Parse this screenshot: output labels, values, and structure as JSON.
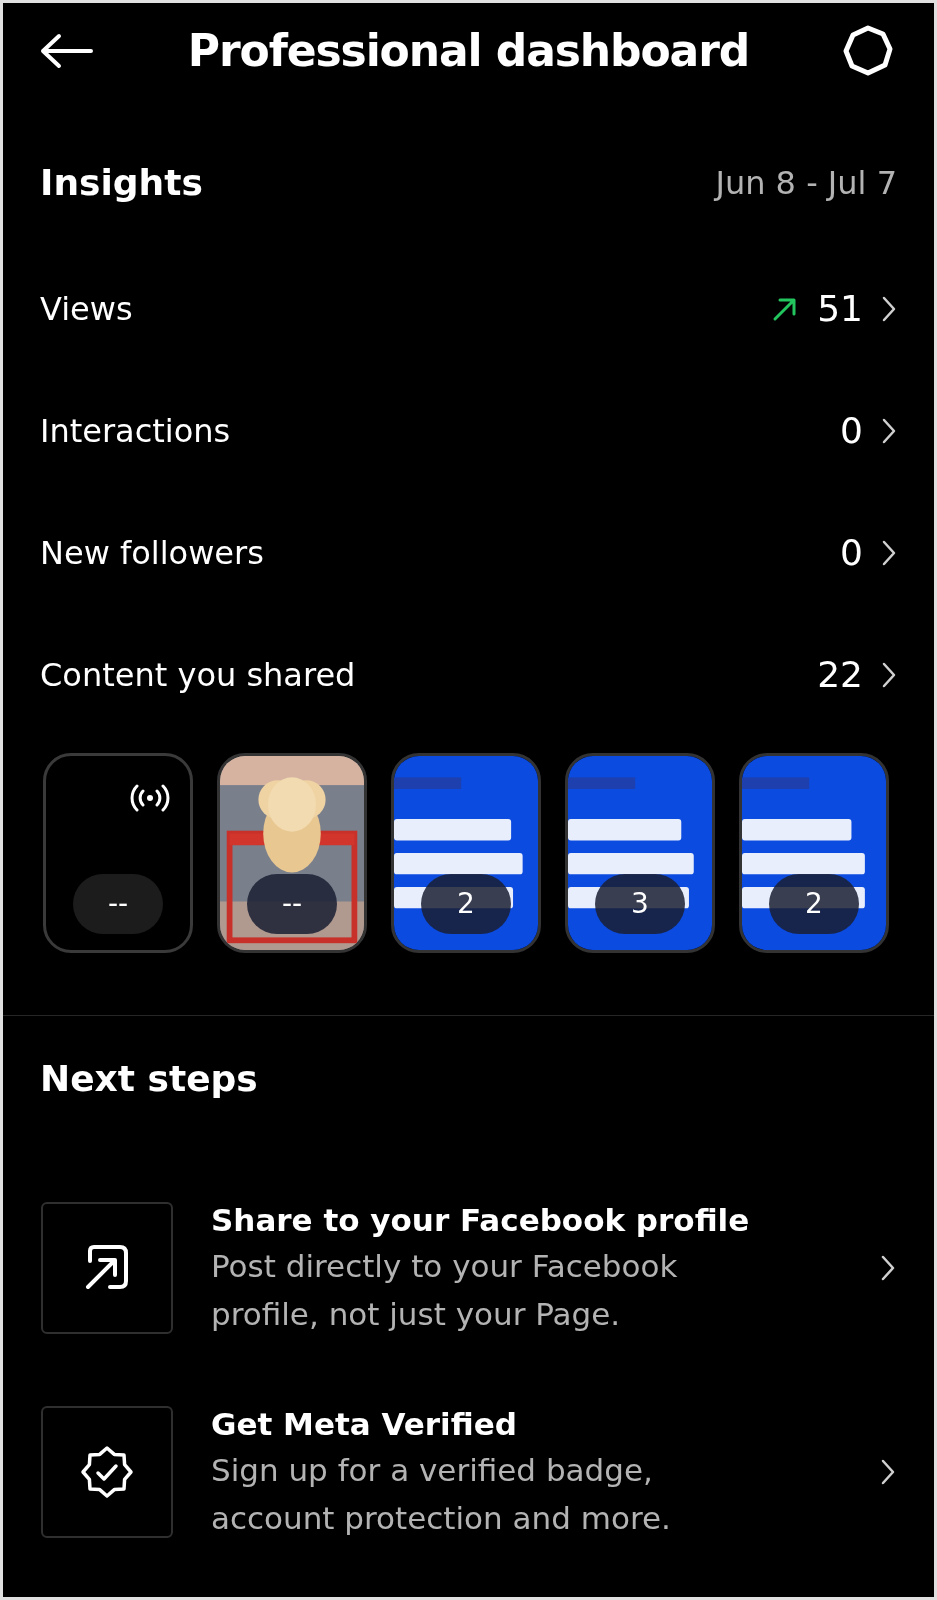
{
  "header": {
    "title": "Professional dashboard"
  },
  "insights": {
    "title": "Insights",
    "date_range": "Jun 8 - Jul 7",
    "metrics": [
      {
        "kind": "trend_up",
        "label": "Views",
        "value": "51"
      },
      {
        "kind": "plain",
        "label": "Interactions",
        "value": "0"
      },
      {
        "kind": "plain",
        "label": "New followers",
        "value": "0"
      },
      {
        "kind": "plain",
        "label": "Content you shared",
        "value": "22"
      }
    ],
    "content": [
      {
        "kind": "live",
        "count": "--"
      },
      {
        "kind": "picture",
        "count": "--"
      },
      {
        "kind": "graphic",
        "count": "2"
      },
      {
        "kind": "graphic",
        "count": "3"
      },
      {
        "kind": "graphic",
        "count": "2"
      }
    ]
  },
  "next_steps": {
    "title": "Next steps",
    "items": [
      {
        "kind": "share",
        "title": "Share to your Facebook profile",
        "description": "Post directly to your Facebook profile, not just your Page."
      },
      {
        "kind": "verified",
        "title": "Get Meta Verified",
        "description": "Sign up for a verified badge, account protection and more."
      }
    ]
  }
}
